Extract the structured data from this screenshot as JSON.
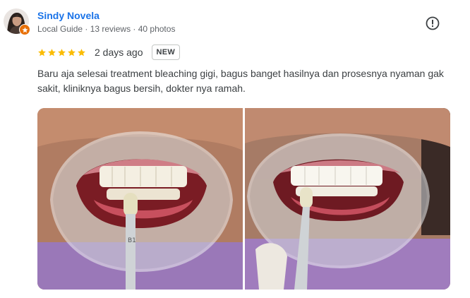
{
  "reviewer": {
    "name": "Sindy Novela",
    "meta": "Local Guide · 13 reviews · 40 photos"
  },
  "review": {
    "rating": 5,
    "rating_max": 5,
    "date": "2 days ago",
    "badge": "NEW",
    "text": "Baru aja selesai treatment bleaching gigi, bagus banget hasilnya dan prosesnya nyaman gak sakit, kliniknya bagus bersih, dokter nya ramah."
  },
  "icons": {
    "more": "exclamation-circle-icon",
    "star": "star-icon",
    "guide": "local-guide-badge-icon"
  },
  "colors": {
    "name": "#1a73e8",
    "star": "#fbbc04",
    "guide_badge": "#e8710a"
  }
}
